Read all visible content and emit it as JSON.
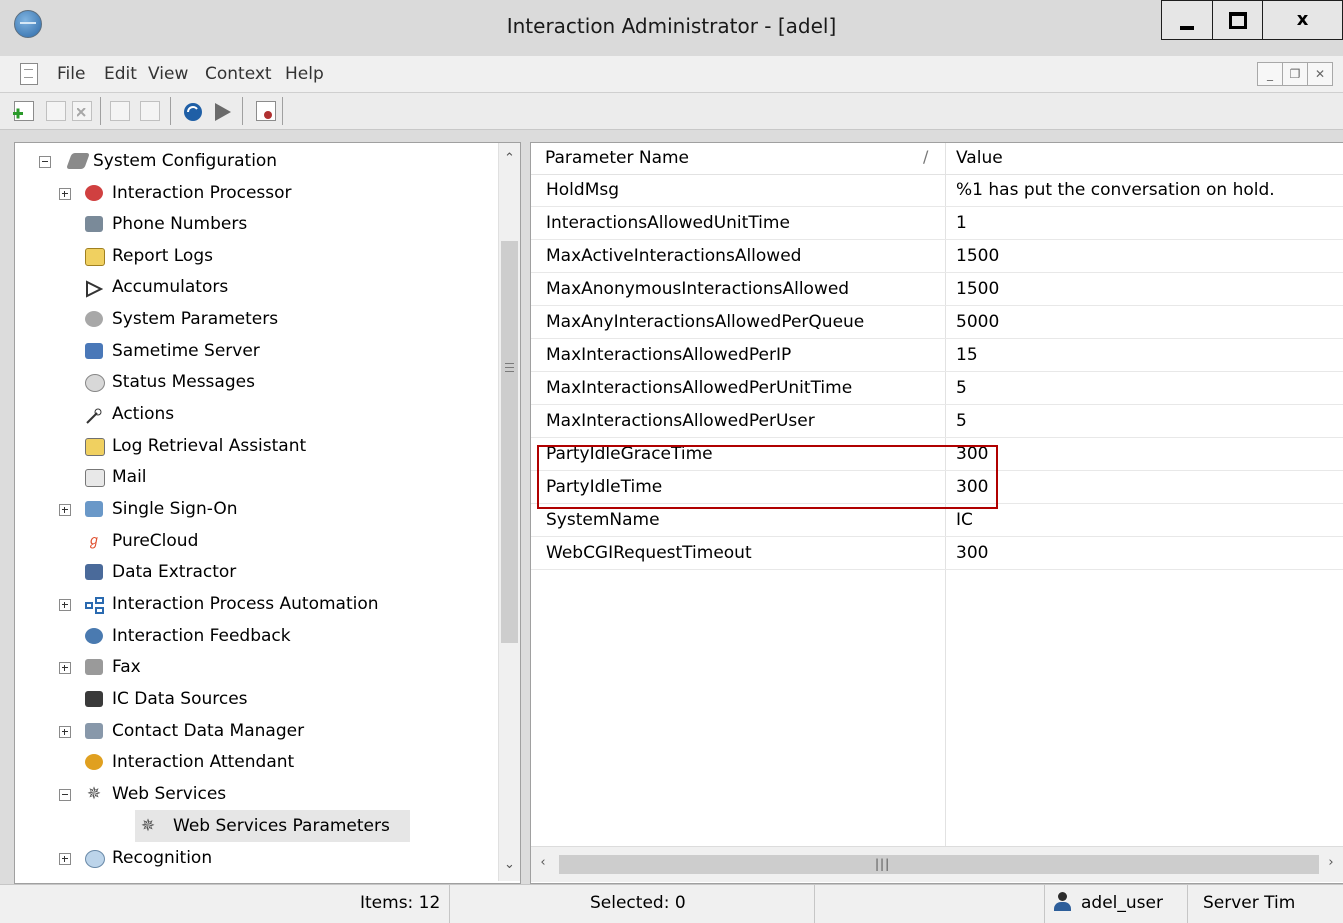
{
  "window": {
    "title": "Interaction Administrator - [adel]",
    "min_label": "",
    "close_label": "x"
  },
  "menu": {
    "items": [
      "File",
      "Edit",
      "View",
      "Context",
      "Help"
    ]
  },
  "tree": {
    "items": [
      {
        "label": "System Configuration",
        "icon": "system-configuration-icon",
        "expander": "minus"
      },
      {
        "label": "Interaction Processor",
        "icon": "interaction-processor-icon",
        "expander": "plus"
      },
      {
        "label": "Phone Numbers",
        "icon": "phone-icon",
        "expander": ""
      },
      {
        "label": "Report Logs",
        "icon": "report-logs-icon",
        "expander": ""
      },
      {
        "label": "Accumulators",
        "icon": "accumulators-icon",
        "expander": ""
      },
      {
        "label": "System Parameters",
        "icon": "gears-icon",
        "expander": ""
      },
      {
        "label": "Sametime Server",
        "icon": "sametime-server-icon",
        "expander": ""
      },
      {
        "label": "Status Messages",
        "icon": "chat-bubble-icon",
        "expander": ""
      },
      {
        "label": "Actions",
        "icon": "wand-icon",
        "expander": ""
      },
      {
        "label": "Log Retrieval Assistant",
        "icon": "log-search-icon",
        "expander": ""
      },
      {
        "label": "Mail",
        "icon": "mail-icon",
        "expander": ""
      },
      {
        "label": "Single Sign-On",
        "icon": "single-sign-on-icon",
        "expander": "plus"
      },
      {
        "label": "PureCloud",
        "icon": "purecloud-icon",
        "expander": ""
      },
      {
        "label": "Data Extractor",
        "icon": "data-extractor-icon",
        "expander": ""
      },
      {
        "label": "Interaction Process Automation",
        "icon": "process-automation-icon",
        "expander": "plus"
      },
      {
        "label": "Interaction Feedback",
        "icon": "feedback-users-icon",
        "expander": ""
      },
      {
        "label": "Fax",
        "icon": "fax-icon",
        "expander": "plus"
      },
      {
        "label": "IC Data Sources",
        "icon": "data-sources-icon",
        "expander": ""
      },
      {
        "label": "Contact Data Manager",
        "icon": "contact-data-icon",
        "expander": "plus"
      },
      {
        "label": "Interaction Attendant",
        "icon": "attendant-icon",
        "expander": ""
      },
      {
        "label": "Web Services",
        "icon": "web-services-icon",
        "expander": "minus"
      },
      {
        "label": "Web Services Parameters",
        "icon": "web-services-parameters-icon",
        "expander": ""
      },
      {
        "label": "Recognition",
        "icon": "recognition-icon",
        "expander": "plus"
      }
    ]
  },
  "list": {
    "header": {
      "name": "Parameter Name",
      "value": "Value"
    },
    "rows": [
      {
        "name": "HoldMsg",
        "value": "%1 has put the conversation on hold."
      },
      {
        "name": "InteractionsAllowedUnitTime",
        "value": "1"
      },
      {
        "name": "MaxActiveInteractionsAllowed",
        "value": "1500"
      },
      {
        "name": "MaxAnonymousInteractionsAllowed",
        "value": "1500"
      },
      {
        "name": "MaxAnyInteractionsAllowedPerQueue",
        "value": "5000"
      },
      {
        "name": "MaxInteractionsAllowedPerIP",
        "value": "15"
      },
      {
        "name": "MaxInteractionsAllowedPerUnitTime",
        "value": "5"
      },
      {
        "name": "MaxInteractionsAllowedPerUser",
        "value": "5"
      },
      {
        "name": "PartyIdleGraceTime",
        "value": "300"
      },
      {
        "name": "PartyIdleTime",
        "value": "300"
      },
      {
        "name": "SystemName",
        "value": "IC"
      },
      {
        "name": "WebCGIRequestTimeout",
        "value": "300"
      }
    ],
    "highlight_color": "#b00000"
  },
  "status": {
    "items": "Items: 12",
    "selected": "Selected: 0",
    "user": "adel_user",
    "server_time": "Server Tim"
  }
}
